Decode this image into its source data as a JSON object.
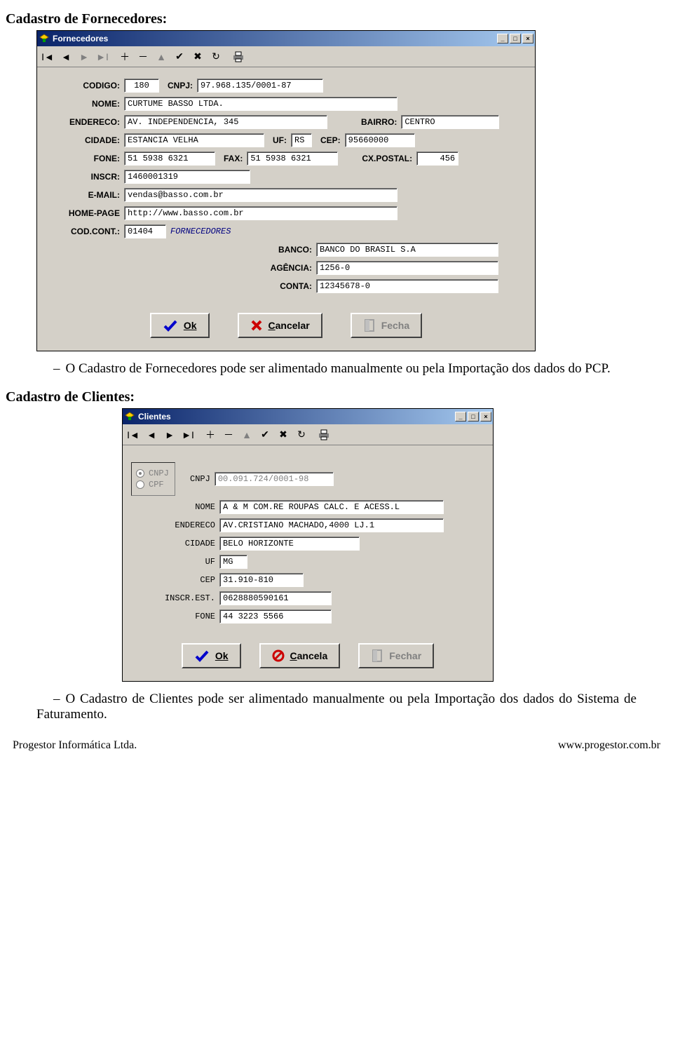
{
  "headings": {
    "fornecedores": "Cadastro de Fornecedores:",
    "clientes": "Cadastro de Clientes:"
  },
  "body_text": {
    "fornecedores": "O Cadastro de Fornecedores pode ser alimentado manualmente  ou pela Importação dos dados do PCP.",
    "clientes": "O Cadastro de Clientes pode ser alimentado manualmente  ou pela Importação dos dados do Sistema de Faturamento."
  },
  "fornecedores_window": {
    "title": "Fornecedores",
    "labels": {
      "codigo": "CODIGO:",
      "cnpj": "CNPJ:",
      "nome": "NOME:",
      "endereco": "ENDERECO:",
      "bairro": "BAIRRO:",
      "cidade": "CIDADE:",
      "uf": "UF:",
      "cep": "CEP:",
      "fone": "FONE:",
      "fax": "FAX:",
      "cxpostal": "CX.POSTAL:",
      "inscr": "INSCR:",
      "email": "E-MAIL:",
      "homepage": "HOME-PAGE",
      "codcont": "COD.CONT.:",
      "banco": "BANCO:",
      "agencia": "AGÊNCIA:",
      "conta": "CONTA:"
    },
    "values": {
      "codigo": "180",
      "cnpj": "97.968.135/0001-87",
      "nome": "CURTUME BASSO LTDA.",
      "endereco": "AV. INDEPENDENCIA, 345",
      "bairro": "CENTRO",
      "cidade": "ESTANCIA VELHA",
      "uf": "RS",
      "cep": "95660000",
      "fone": "51 5938 6321",
      "fax": "51 5938 6321",
      "cxpostal": "456",
      "inscr": "1460001319",
      "email": "vendas@basso.com.br",
      "homepage": "http://www.basso.com.br",
      "codcont": "01404",
      "codcont_helper": "FORNECEDORES",
      "banco": "BANCO DO BRASIL S.A",
      "agencia": "1256-0",
      "conta": "12345678-0"
    },
    "buttons": {
      "ok": "Ok",
      "cancelar": "Cancelar",
      "fecha": "Fecha"
    }
  },
  "clientes_window": {
    "title": "Clientes",
    "labels": {
      "cnpj_radio": "CNPJ",
      "cpf_radio": "CPF",
      "cnpj": "CNPJ",
      "nome": "NOME",
      "endereco": "ENDERECO",
      "cidade": "CIDADE",
      "uf": "UF",
      "cep": "CEP",
      "inscrest": "INSCR.EST.",
      "fone": "FONE"
    },
    "values": {
      "cnpj": "00.091.724/0001-98",
      "nome": "A & M COM.RE ROUPAS CALC. E ACESS.L",
      "endereco": "AV.CRISTIANO MACHADO,4000 LJ.1",
      "cidade": "BELO HORIZONTE",
      "uf": "MG",
      "cep": "31.910-810",
      "inscrest": "0628880590161",
      "fone": "44 3223 5566"
    },
    "buttons": {
      "ok": "Ok",
      "cancela": "Cancela",
      "fechar": "Fechar"
    }
  },
  "footer": {
    "left": "Progestor Informática Ltda.",
    "right": "www.progestor.com.br"
  }
}
